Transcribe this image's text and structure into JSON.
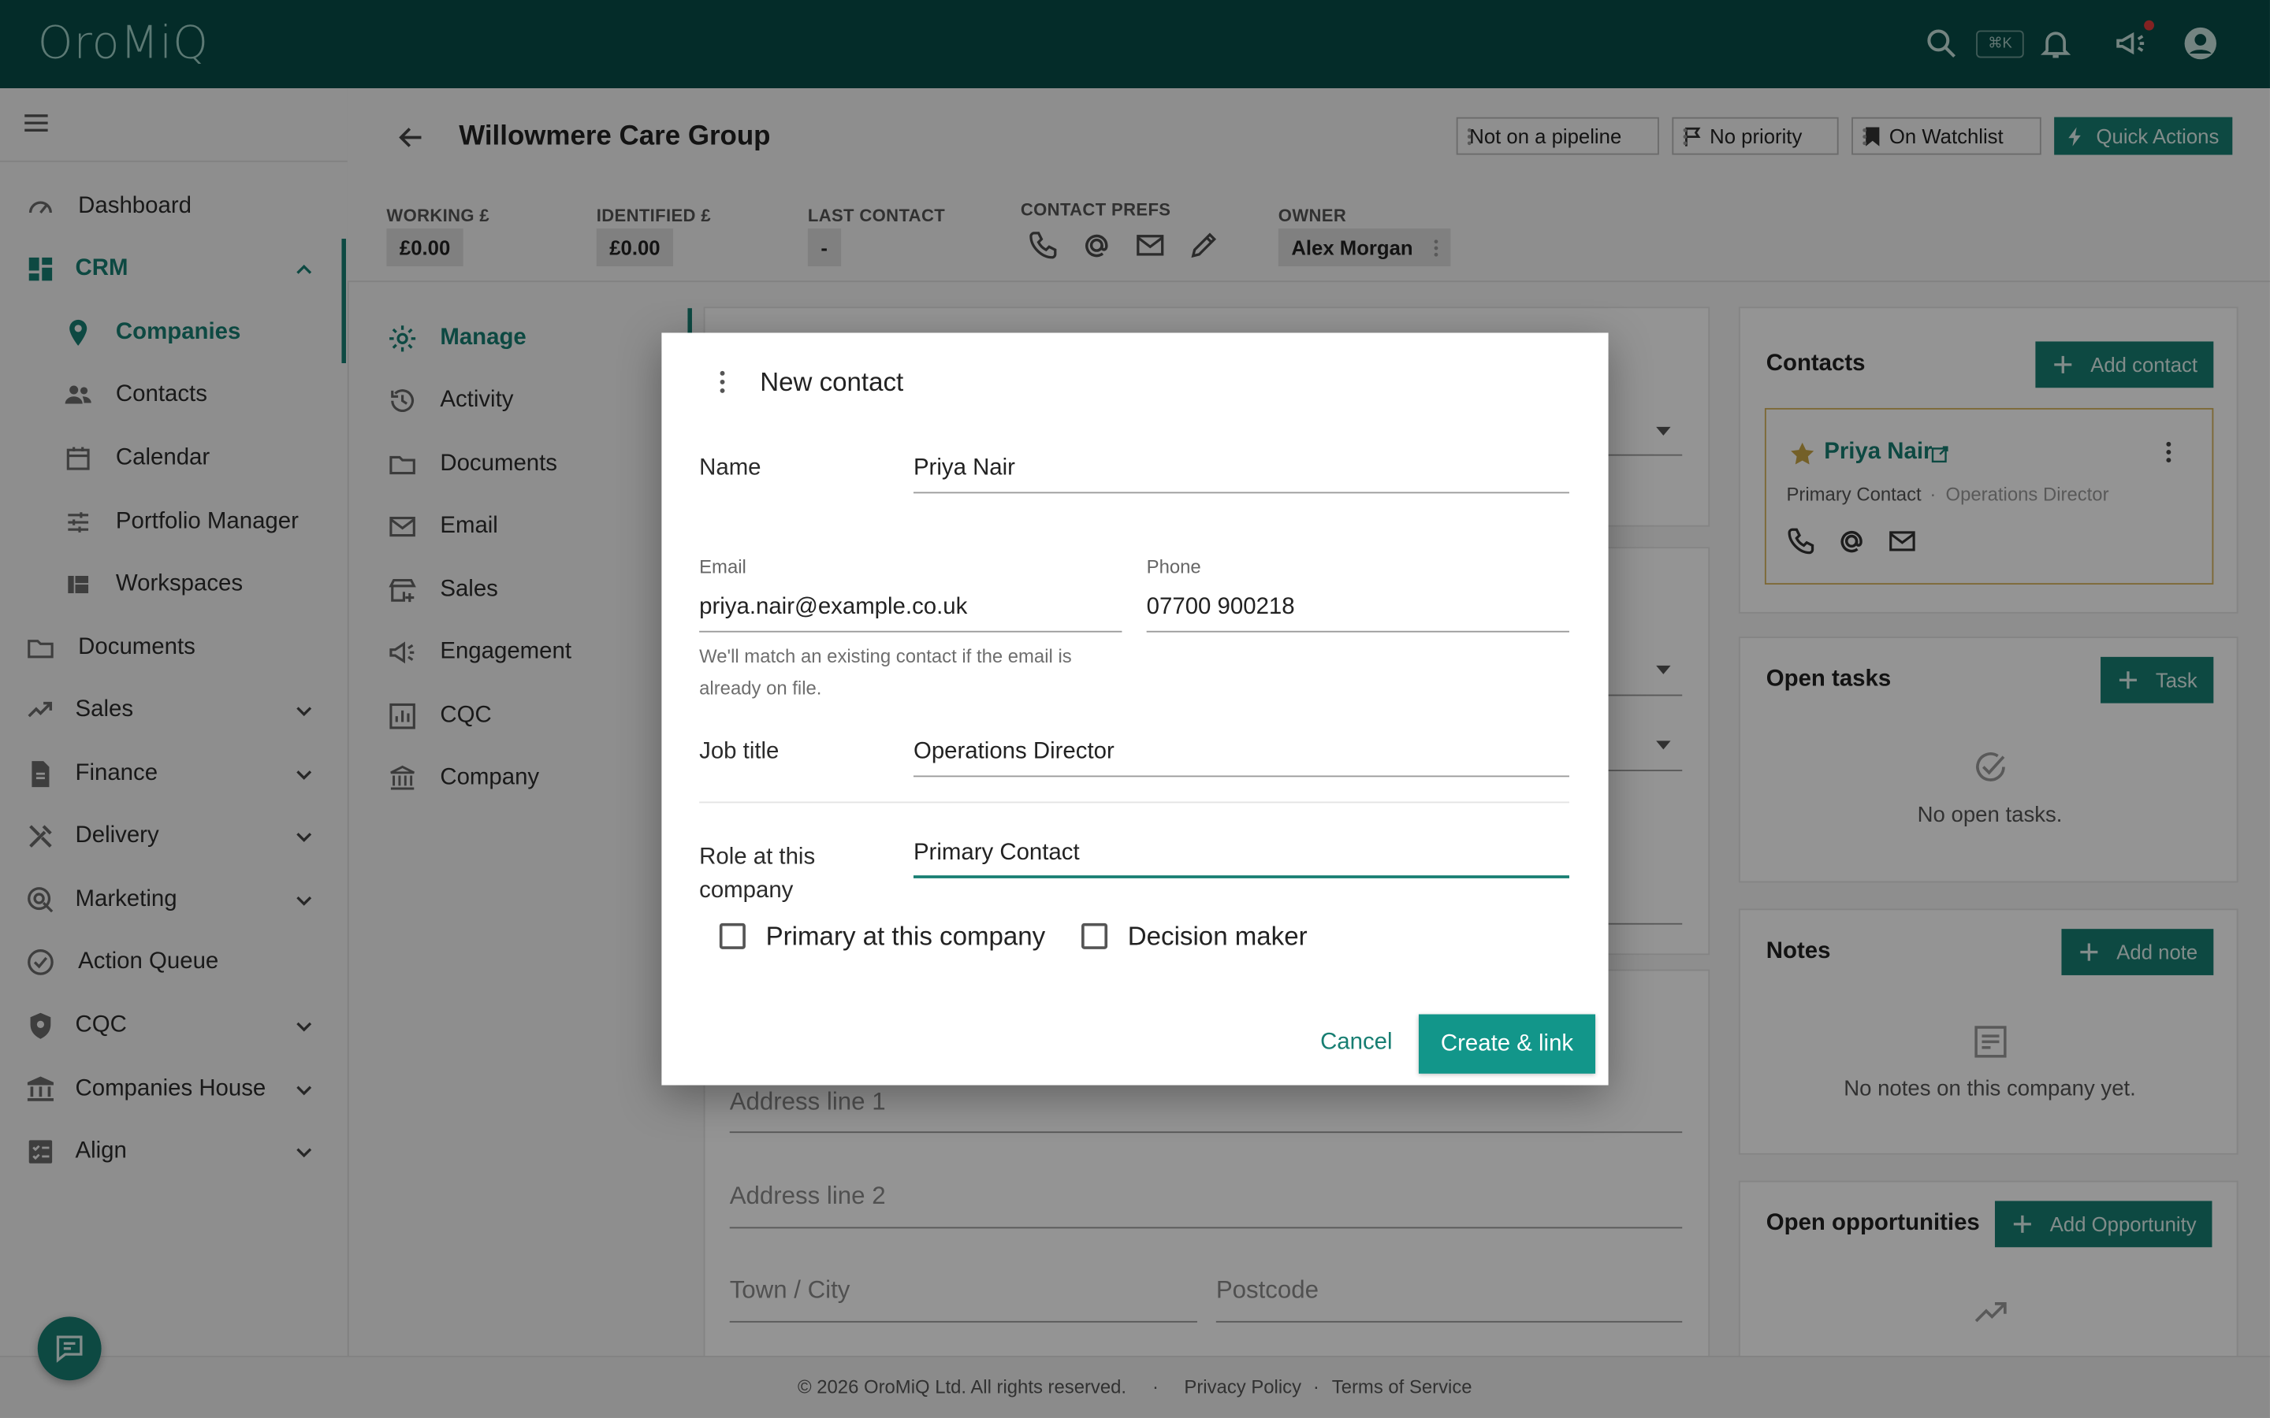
{
  "app": {
    "logo": "OroMiQ",
    "shortcut": "⌘K"
  },
  "sidebar": {
    "items": [
      {
        "label": "Dashboard",
        "icon": "gauge-icon"
      },
      {
        "label": "CRM",
        "icon": "dashboard-grid-icon"
      },
      {
        "label": "Companies",
        "icon": "map-pin-icon"
      },
      {
        "label": "Contacts",
        "icon": "people-icon"
      },
      {
        "label": "Calendar",
        "icon": "calendar-icon"
      },
      {
        "label": "Portfolio Manager",
        "icon": "sliders-icon"
      },
      {
        "label": "Workspaces",
        "icon": "workspaces-icon"
      },
      {
        "label": "Documents",
        "icon": "folder-icon"
      },
      {
        "label": "Sales",
        "icon": "trending-up-icon"
      },
      {
        "label": "Finance",
        "icon": "invoice-icon"
      },
      {
        "label": "Delivery",
        "icon": "tools-icon"
      },
      {
        "label": "Marketing",
        "icon": "target-icon"
      },
      {
        "label": "Action Queue",
        "icon": "check-circle-icon"
      },
      {
        "label": "CQC",
        "icon": "shield-icon"
      },
      {
        "label": "Companies House",
        "icon": "bank-icon"
      },
      {
        "label": "Align",
        "icon": "checklist-icon"
      }
    ]
  },
  "header": {
    "title": "Willowmere Care Group",
    "pipeline": "Not on a pipeline",
    "priority": "No priority",
    "watchlist": "On Watchlist",
    "quick_actions": "Quick Actions",
    "stats": {
      "working_label": "WORKING £",
      "working_value": "£0.00",
      "identified_label": "IDENTIFIED £",
      "identified_value": "£0.00",
      "last_contact_label": "LAST CONTACT",
      "last_contact_value": "-",
      "contact_prefs_label": "CONTACT PREFS",
      "owner_label": "OWNER",
      "owner_value": "Alex Morgan"
    }
  },
  "subnav": {
    "items": [
      {
        "label": "Manage"
      },
      {
        "label": "Activity"
      },
      {
        "label": "Documents"
      },
      {
        "label": "Email"
      },
      {
        "label": "Sales"
      },
      {
        "label": "Engagement"
      },
      {
        "label": "CQC"
      },
      {
        "label": "Company"
      }
    ]
  },
  "form_bg": {
    "address1": "Address line 1",
    "address2": "Address line 2",
    "town": "Town / City",
    "postcode": "Postcode"
  },
  "right": {
    "contacts_title": "Contacts",
    "add_contact": "Add contact",
    "contact": {
      "name": "Priya Nair",
      "role": "Primary Contact",
      "separator": "·",
      "job": "Operations Director"
    },
    "tasks_title": "Open tasks",
    "task_btn": "Task",
    "no_tasks": "No open tasks.",
    "notes_title": "Notes",
    "add_note": "Add note",
    "no_notes": "No notes on this company yet.",
    "opps_title": "Open opportunities",
    "add_opp": "Add Opportunity"
  },
  "footer": {
    "copyright": "© 2026 OroMiQ Ltd. All rights reserved.",
    "sep1": "·",
    "privacy": "Privacy Policy",
    "sep2": "·",
    "terms": "Terms of Service"
  },
  "dialog": {
    "title": "New contact",
    "name_label": "Name",
    "name_value": "Priya Nair",
    "email_label": "Email",
    "email_value": "priya.nair@example.co.uk",
    "email_hint_1": "We'll match an existing contact if the email is",
    "email_hint_2": "already on file.",
    "phone_label": "Phone",
    "phone_value": "07700 900218",
    "job_label": "Job title",
    "job_value": "Operations Director",
    "role_label_1": "Role at this",
    "role_label_2": "company",
    "role_value": "Primary Contact",
    "primary_label": "Primary at this company",
    "decision_label": "Decision maker",
    "cancel": "Cancel",
    "create": "Create & link"
  },
  "colors": {
    "brand": "#074d47",
    "accent": "#177e72",
    "highlight": "#d7b35a"
  }
}
